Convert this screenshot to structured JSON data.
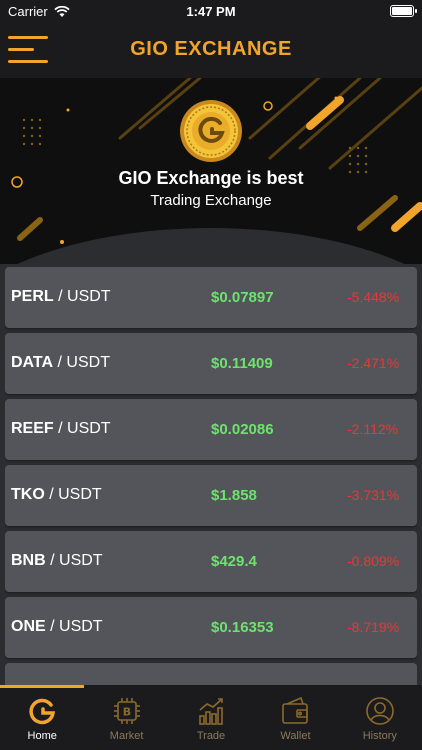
{
  "status": {
    "carrier": "Carrier",
    "time": "1:47 PM"
  },
  "header": {
    "title": "GIO EXCHANGE"
  },
  "banner": {
    "title": "GIO Exchange is best",
    "subtitle": "Trading Exchange"
  },
  "market": {
    "rows": [
      {
        "base": "PERL",
        "quote": "/ USDT",
        "price": "$0.07897",
        "change": "-5.448%"
      },
      {
        "base": "DATA",
        "quote": "/ USDT",
        "price": "$0.11409",
        "change": "-2.471%"
      },
      {
        "base": "REEF",
        "quote": "/ USDT",
        "price": "$0.02086",
        "change": "-2.112%"
      },
      {
        "base": "TKO",
        "quote": "/ USDT",
        "price": "$1.858",
        "change": "-3.731%"
      },
      {
        "base": "BNB",
        "quote": "/ USDT",
        "price": "$429.4",
        "change": "-0.809%"
      },
      {
        "base": "ONE",
        "quote": "/ USDT",
        "price": "$0.16353",
        "change": "-8.719%"
      }
    ]
  },
  "tabs": [
    {
      "label": "Home",
      "icon": "home-g-icon"
    },
    {
      "label": "Market",
      "icon": "bitcoin-chip-icon"
    },
    {
      "label": "Trade",
      "icon": "chart-icon"
    },
    {
      "label": "Wallet",
      "icon": "wallet-icon"
    },
    {
      "label": "History",
      "icon": "user-icon"
    }
  ],
  "colors": {
    "accent": "#f2a52b",
    "positive": "#6de36d",
    "negative": "#e53935"
  }
}
